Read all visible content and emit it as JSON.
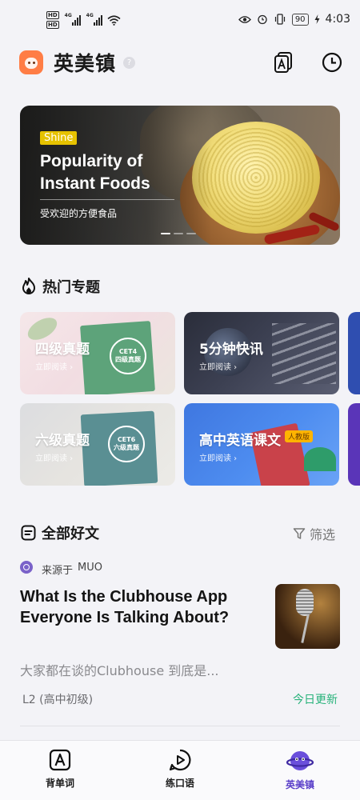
{
  "status_bar": {
    "hd_labels": [
      "HD",
      "HD"
    ],
    "network_labels": [
      "4G",
      "4G"
    ],
    "battery": "90",
    "time": "4:03",
    "icons": [
      "eye-icon",
      "alarm-icon",
      "vibrate-icon",
      "battery-icon",
      "charging-icon",
      "wifi-icon"
    ]
  },
  "header": {
    "app_title": "英美镇",
    "help_glyph": "?",
    "icons": [
      "app-logo-icon",
      "help-icon",
      "translate-card-icon",
      "history-clock-icon"
    ]
  },
  "banner": {
    "tag": "Shine",
    "title": "Popularity of Instant Foods",
    "subtitle": "受欢迎的方便食品",
    "slide_count": 3,
    "active_slide": 1
  },
  "hot_topics": {
    "title": "热门专题",
    "icon": "flame-icon",
    "cards": [
      {
        "title": "四级真题",
        "subtitle": "立即阅读 ›",
        "book_mark": "CET4\n四级真题"
      },
      {
        "title": "5分钟快讯",
        "subtitle": "立即阅读 ›"
      },
      {
        "title": "六级真题",
        "subtitle": "立即阅读 ›",
        "book_mark": "CET6\n六级真题"
      },
      {
        "title": "高中英语课文",
        "subtitle": "立即阅读 ›",
        "badge": "人教版"
      }
    ]
  },
  "all_articles": {
    "title": "全部好文",
    "icon": "article-list-icon",
    "filter_label": "筛选",
    "filter_icon": "funnel-icon"
  },
  "article": {
    "source_label": "来源于",
    "source_name": "MUO",
    "title": "What Is the Clubhouse App Everyone Is Talking About?",
    "summary": "大家都在谈的Clubhouse 到底是...",
    "level": "L2 (高中初级)",
    "update": "今日更新"
  },
  "bottom_nav": {
    "items": [
      {
        "label": "背单词",
        "icon": "vocab-a-icon"
      },
      {
        "label": "练口语",
        "icon": "speak-play-icon"
      },
      {
        "label": "英美镇",
        "icon": "planet-mascot-icon",
        "active": true
      }
    ]
  },
  "colors": {
    "accent": "#5a3fc9",
    "update_green": "#27b27a",
    "logo_orange": "#ff7d45",
    "tag_yellow": "#e6c200",
    "badge_yellow": "#ffb400"
  }
}
